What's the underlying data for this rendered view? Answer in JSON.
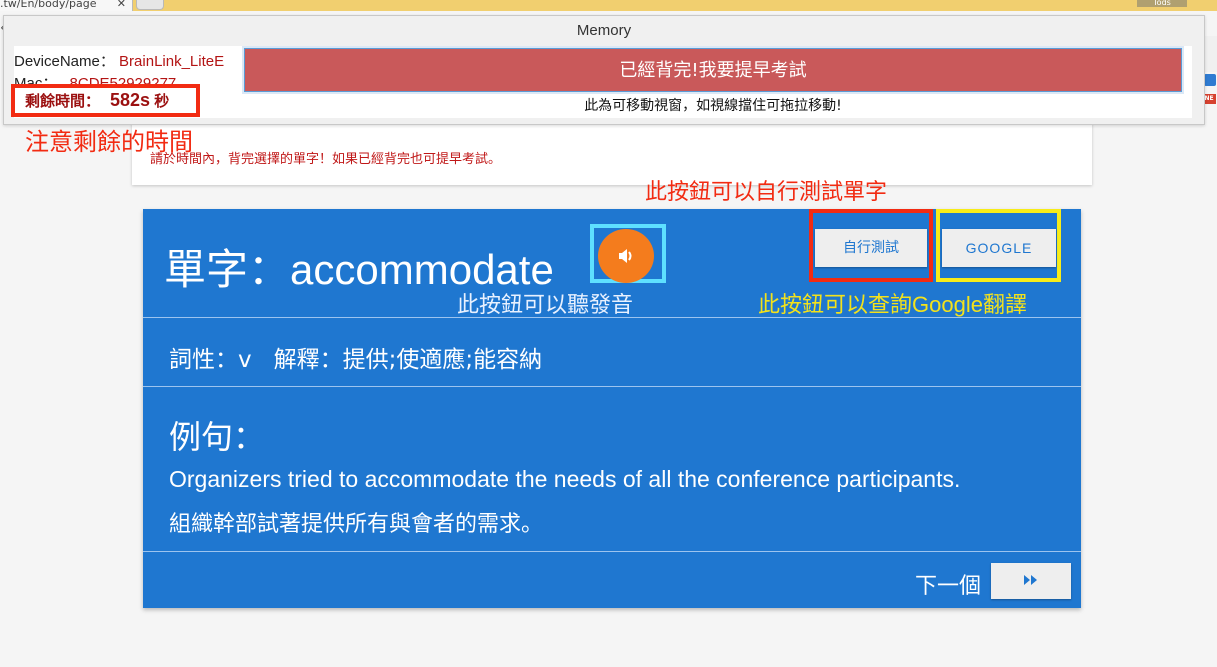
{
  "browser": {
    "tab_url_fragment": ".tw/En/body/page",
    "tab_close": "✕",
    "right_tab_label": "Tods",
    "ext_badge": "NE"
  },
  "memory_window": {
    "title": "Memory",
    "device_name_label": "DeviceName：",
    "device_name_value": "BrainLink_LiteE",
    "mac_label": "Mac：",
    "mac_value": "8CDE52929277",
    "timer_label": "剩餘時間：",
    "timer_value": "582s",
    "timer_unit": "秒",
    "early_exam_button": "已經背完!我要提早考試",
    "movable_note": "此為可移動視窗，如視線擋住可拖拉移動!"
  },
  "annotations": {
    "remaining_time_note": "注意剩餘的時間",
    "self_test_note": "此按鈕可以自行測試單字",
    "pronounce_note": "此按鈕可以聽發音",
    "google_note": "此按鈕可以查詢Google翻譯"
  },
  "instruction": {
    "text": "請於時間內，背完選擇的單字！如果已經背完也可提早考試。"
  },
  "word_card": {
    "word_label": "單字：",
    "word": "accommodate",
    "self_test_button": "自行測試",
    "google_button": "GOOGLE",
    "pos_label": "詞性：",
    "pos_value": "v",
    "meaning_label": "解釋：",
    "meaning_value": "提供;使適應;能容納",
    "example_label": "例句：",
    "example_en": "Organizers tried to accommodate the needs of all the conference participants.",
    "example_zh": "組織幹部試著提供所有與會者的需求。",
    "next_label": "下一個"
  },
  "colors": {
    "card_blue": "#1f77d0",
    "sound_orange": "#f47c1d",
    "early_button_red": "#c9595a",
    "annotation_red": "#f22b12",
    "annotation_yellow": "#f7ec19",
    "annotation_cyan": "#5ee0ff"
  }
}
